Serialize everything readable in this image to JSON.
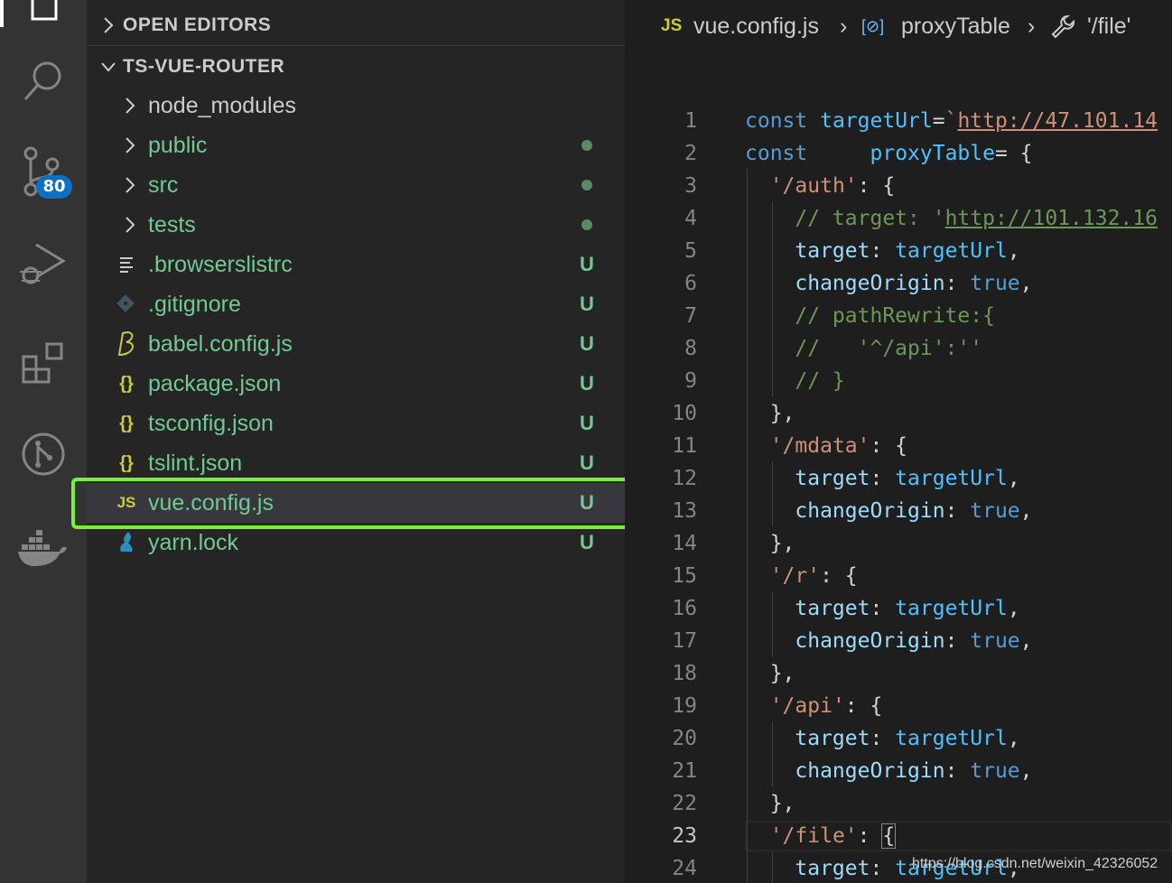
{
  "activity_bar": {
    "items": [
      {
        "icon": "files-icon"
      },
      {
        "icon": "search-icon"
      },
      {
        "icon": "source-control-icon",
        "badge": "80"
      },
      {
        "icon": "run-debug-icon"
      },
      {
        "icon": "extensions-icon"
      },
      {
        "icon": "git-graph-icon"
      },
      {
        "icon": "docker-icon"
      }
    ]
  },
  "sidebar": {
    "open_editors_label": "OPEN EDITORS",
    "project_label": "TS-VUE-ROUTER",
    "items": [
      {
        "name": "node_modules",
        "type": "folder",
        "status": ""
      },
      {
        "name": "public",
        "type": "folder",
        "status": "dot"
      },
      {
        "name": "src",
        "type": "folder",
        "status": "dot"
      },
      {
        "name": "tests",
        "type": "folder",
        "status": "dot"
      },
      {
        "name": ".browserslistrc",
        "type": "file",
        "icon": "lines-icon",
        "status": "U"
      },
      {
        "name": ".gitignore",
        "type": "file",
        "icon": "git-icon",
        "status": "U"
      },
      {
        "name": "babel.config.js",
        "type": "file",
        "icon": "babel-icon",
        "status": "U"
      },
      {
        "name": "package.json",
        "type": "file",
        "icon": "json-icon",
        "icon_text": "{}",
        "status": "U"
      },
      {
        "name": "tsconfig.json",
        "type": "file",
        "icon": "json-icon",
        "icon_text": "{}",
        "status": "U"
      },
      {
        "name": "tslint.json",
        "type": "file",
        "icon": "json-icon",
        "icon_text": "{}",
        "status": "U"
      },
      {
        "name": "vue.config.js",
        "type": "file",
        "icon": "js-icon",
        "icon_text": "JS",
        "status": "U",
        "selected": true
      },
      {
        "name": "yarn.lock",
        "type": "file",
        "icon": "yarn-icon",
        "status": "U"
      }
    ]
  },
  "breadcrumb": {
    "file_badge": "JS",
    "file": "vue.config.js",
    "symbol_badge": "[⊘]",
    "symbol": "proxyTable",
    "property": "'/file'"
  },
  "editor": {
    "lines": [
      {
        "n": "1",
        "tokens": [
          [
            "kw",
            "const"
          ],
          [
            "pn",
            " "
          ],
          [
            "var",
            "targetUrl"
          ],
          [
            "pn",
            "="
          ],
          [
            "str",
            "`"
          ],
          [
            "url",
            "http://47.101.14"
          ]
        ]
      },
      {
        "n": "2",
        "tokens": [
          [
            "kw",
            "const"
          ],
          [
            "pn",
            "     "
          ],
          [
            "var",
            "proxyTable"
          ],
          [
            "pn",
            "= {"
          ]
        ]
      },
      {
        "n": "3",
        "tokens": [
          [
            "pn",
            "  "
          ],
          [
            "str",
            "'/auth'"
          ],
          [
            "pn",
            ": {"
          ]
        ]
      },
      {
        "n": "4",
        "tokens": [
          [
            "pn",
            "    "
          ],
          [
            "cm",
            "// target: '"
          ],
          [
            "cmurl",
            "http://101.132.16"
          ]
        ]
      },
      {
        "n": "5",
        "tokens": [
          [
            "pn",
            "    "
          ],
          [
            "prop",
            "target"
          ],
          [
            "pn",
            ": "
          ],
          [
            "var",
            "targetUrl"
          ],
          [
            "pn",
            ","
          ]
        ]
      },
      {
        "n": "6",
        "tokens": [
          [
            "pn",
            "    "
          ],
          [
            "prop",
            "changeOrigin"
          ],
          [
            "pn",
            ": "
          ],
          [
            "bool",
            "true"
          ],
          [
            "pn",
            ","
          ]
        ]
      },
      {
        "n": "7",
        "tokens": [
          [
            "pn",
            "    "
          ],
          [
            "cm",
            "// pathRewrite:{"
          ]
        ]
      },
      {
        "n": "8",
        "tokens": [
          [
            "pn",
            "    "
          ],
          [
            "cm",
            "//   '^/api':''"
          ]
        ]
      },
      {
        "n": "9",
        "tokens": [
          [
            "pn",
            "    "
          ],
          [
            "cm",
            "// }"
          ]
        ]
      },
      {
        "n": "10",
        "tokens": [
          [
            "pn",
            "  },"
          ]
        ]
      },
      {
        "n": "11",
        "tokens": [
          [
            "pn",
            "  "
          ],
          [
            "str",
            "'/mdata'"
          ],
          [
            "pn",
            ": {"
          ]
        ]
      },
      {
        "n": "12",
        "tokens": [
          [
            "pn",
            "    "
          ],
          [
            "prop",
            "target"
          ],
          [
            "pn",
            ": "
          ],
          [
            "var",
            "targetUrl"
          ],
          [
            "pn",
            ","
          ]
        ]
      },
      {
        "n": "13",
        "tokens": [
          [
            "pn",
            "    "
          ],
          [
            "prop",
            "changeOrigin"
          ],
          [
            "pn",
            ": "
          ],
          [
            "bool",
            "true"
          ],
          [
            "pn",
            ","
          ]
        ]
      },
      {
        "n": "14",
        "tokens": [
          [
            "pn",
            "  },"
          ]
        ]
      },
      {
        "n": "15",
        "tokens": [
          [
            "pn",
            "  "
          ],
          [
            "str",
            "'/r'"
          ],
          [
            "pn",
            ": {"
          ]
        ]
      },
      {
        "n": "16",
        "tokens": [
          [
            "pn",
            "    "
          ],
          [
            "prop",
            "target"
          ],
          [
            "pn",
            ": "
          ],
          [
            "var",
            "targetUrl"
          ],
          [
            "pn",
            ","
          ]
        ]
      },
      {
        "n": "17",
        "tokens": [
          [
            "pn",
            "    "
          ],
          [
            "prop",
            "changeOrigin"
          ],
          [
            "pn",
            ": "
          ],
          [
            "bool",
            "true"
          ],
          [
            "pn",
            ","
          ]
        ]
      },
      {
        "n": "18",
        "tokens": [
          [
            "pn",
            "  },"
          ]
        ]
      },
      {
        "n": "19",
        "tokens": [
          [
            "pn",
            "  "
          ],
          [
            "str",
            "'/api'"
          ],
          [
            "pn",
            ": {"
          ]
        ]
      },
      {
        "n": "20",
        "tokens": [
          [
            "pn",
            "    "
          ],
          [
            "prop",
            "target"
          ],
          [
            "pn",
            ": "
          ],
          [
            "var",
            "targetUrl"
          ],
          [
            "pn",
            ","
          ]
        ]
      },
      {
        "n": "21",
        "tokens": [
          [
            "pn",
            "    "
          ],
          [
            "prop",
            "changeOrigin"
          ],
          [
            "pn",
            ": "
          ],
          [
            "bool",
            "true"
          ],
          [
            "pn",
            ","
          ]
        ]
      },
      {
        "n": "22",
        "tokens": [
          [
            "pn",
            "  },"
          ]
        ]
      },
      {
        "n": "23",
        "active": true,
        "tokens": [
          [
            "pn",
            "  "
          ],
          [
            "str",
            "'/file'"
          ],
          [
            "pn",
            ": "
          ],
          [
            "bracket",
            "{"
          ]
        ]
      },
      {
        "n": "24",
        "tokens": [
          [
            "pn",
            "    "
          ],
          [
            "prop",
            "target"
          ],
          [
            "pn",
            ": "
          ],
          [
            "var",
            "targetUrl"
          ],
          [
            "pn",
            ","
          ]
        ]
      }
    ]
  },
  "watermark": "https://blog.csdn.net/weixin_42326052"
}
